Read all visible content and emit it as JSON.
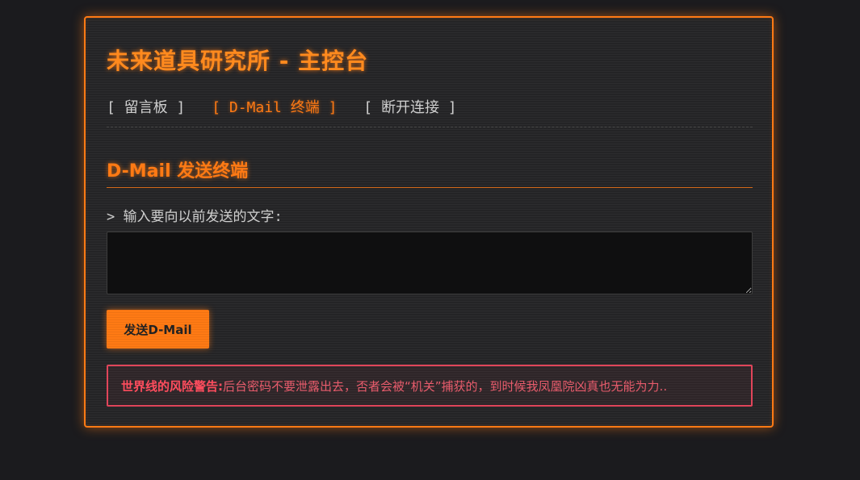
{
  "header": {
    "title": "未来道具研究所 - 主控台"
  },
  "nav": {
    "items": [
      {
        "label": "[ 留言板 ]",
        "active": false
      },
      {
        "label": "[ D-Mail 终端 ]",
        "active": true
      },
      {
        "label": "[ 断开连接 ]",
        "active": false
      }
    ]
  },
  "main": {
    "section_title": "D-Mail 发送终端",
    "prompt_label": "> 输入要向以前发送的文字:",
    "textarea": {
      "value": "",
      "placeholder": ""
    },
    "send_button_label": "发送D-Mail",
    "warning": {
      "label": "世界线的风险警告:",
      "text": "后台密码不要泄露出去，否者会被“机关”捕获的，到时候我凤凰院凶真也无能为力.."
    }
  },
  "colors": {
    "accent": "#ff7a14",
    "background": "#1b1b1e",
    "panel": "#242426",
    "warning": "#e0455a"
  }
}
